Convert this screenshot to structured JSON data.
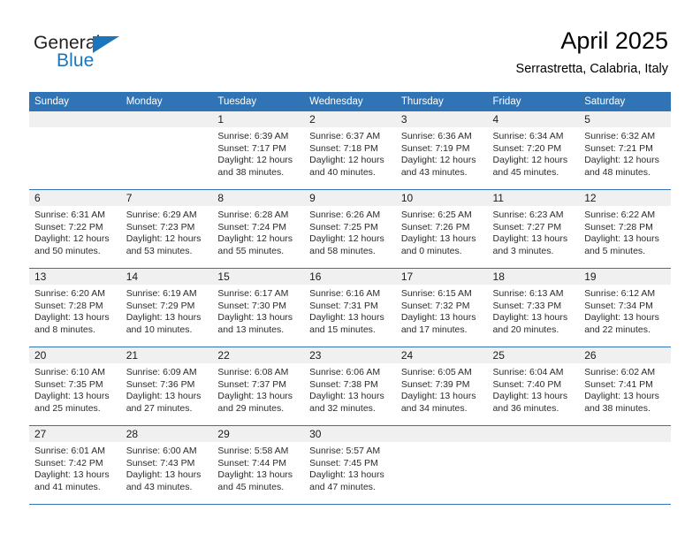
{
  "brand": {
    "name_part1": "General",
    "name_part2": "Blue",
    "flag_icon": "blue-triangle-flag"
  },
  "header": {
    "title": "April 2025",
    "subtitle": "Serrastretta, Calabria, Italy"
  },
  "colors": {
    "header_blue": "#3174b5",
    "brand_blue": "#1b75bb",
    "daynum_band": "#f0f0f0",
    "text": "#2b2b2b"
  },
  "calendar": {
    "weekdays": [
      "Sunday",
      "Monday",
      "Tuesday",
      "Wednesday",
      "Thursday",
      "Friday",
      "Saturday"
    ],
    "weeks": [
      [
        {
          "day": "",
          "blank": true
        },
        {
          "day": "",
          "blank": true
        },
        {
          "day": "1",
          "sunrise": "Sunrise: 6:39 AM",
          "sunset": "Sunset: 7:17 PM",
          "daylight": "Daylight: 12 hours and 38 minutes."
        },
        {
          "day": "2",
          "sunrise": "Sunrise: 6:37 AM",
          "sunset": "Sunset: 7:18 PM",
          "daylight": "Daylight: 12 hours and 40 minutes."
        },
        {
          "day": "3",
          "sunrise": "Sunrise: 6:36 AM",
          "sunset": "Sunset: 7:19 PM",
          "daylight": "Daylight: 12 hours and 43 minutes."
        },
        {
          "day": "4",
          "sunrise": "Sunrise: 6:34 AM",
          "sunset": "Sunset: 7:20 PM",
          "daylight": "Daylight: 12 hours and 45 minutes."
        },
        {
          "day": "5",
          "sunrise": "Sunrise: 6:32 AM",
          "sunset": "Sunset: 7:21 PM",
          "daylight": "Daylight: 12 hours and 48 minutes."
        }
      ],
      [
        {
          "day": "6",
          "sunrise": "Sunrise: 6:31 AM",
          "sunset": "Sunset: 7:22 PM",
          "daylight": "Daylight: 12 hours and 50 minutes."
        },
        {
          "day": "7",
          "sunrise": "Sunrise: 6:29 AM",
          "sunset": "Sunset: 7:23 PM",
          "daylight": "Daylight: 12 hours and 53 minutes."
        },
        {
          "day": "8",
          "sunrise": "Sunrise: 6:28 AM",
          "sunset": "Sunset: 7:24 PM",
          "daylight": "Daylight: 12 hours and 55 minutes."
        },
        {
          "day": "9",
          "sunrise": "Sunrise: 6:26 AM",
          "sunset": "Sunset: 7:25 PM",
          "daylight": "Daylight: 12 hours and 58 minutes."
        },
        {
          "day": "10",
          "sunrise": "Sunrise: 6:25 AM",
          "sunset": "Sunset: 7:26 PM",
          "daylight": "Daylight: 13 hours and 0 minutes."
        },
        {
          "day": "11",
          "sunrise": "Sunrise: 6:23 AM",
          "sunset": "Sunset: 7:27 PM",
          "daylight": "Daylight: 13 hours and 3 minutes."
        },
        {
          "day": "12",
          "sunrise": "Sunrise: 6:22 AM",
          "sunset": "Sunset: 7:28 PM",
          "daylight": "Daylight: 13 hours and 5 minutes."
        }
      ],
      [
        {
          "day": "13",
          "sunrise": "Sunrise: 6:20 AM",
          "sunset": "Sunset: 7:28 PM",
          "daylight": "Daylight: 13 hours and 8 minutes."
        },
        {
          "day": "14",
          "sunrise": "Sunrise: 6:19 AM",
          "sunset": "Sunset: 7:29 PM",
          "daylight": "Daylight: 13 hours and 10 minutes."
        },
        {
          "day": "15",
          "sunrise": "Sunrise: 6:17 AM",
          "sunset": "Sunset: 7:30 PM",
          "daylight": "Daylight: 13 hours and 13 minutes."
        },
        {
          "day": "16",
          "sunrise": "Sunrise: 6:16 AM",
          "sunset": "Sunset: 7:31 PM",
          "daylight": "Daylight: 13 hours and 15 minutes."
        },
        {
          "day": "17",
          "sunrise": "Sunrise: 6:15 AM",
          "sunset": "Sunset: 7:32 PM",
          "daylight": "Daylight: 13 hours and 17 minutes."
        },
        {
          "day": "18",
          "sunrise": "Sunrise: 6:13 AM",
          "sunset": "Sunset: 7:33 PM",
          "daylight": "Daylight: 13 hours and 20 minutes."
        },
        {
          "day": "19",
          "sunrise": "Sunrise: 6:12 AM",
          "sunset": "Sunset: 7:34 PM",
          "daylight": "Daylight: 13 hours and 22 minutes."
        }
      ],
      [
        {
          "day": "20",
          "sunrise": "Sunrise: 6:10 AM",
          "sunset": "Sunset: 7:35 PM",
          "daylight": "Daylight: 13 hours and 25 minutes."
        },
        {
          "day": "21",
          "sunrise": "Sunrise: 6:09 AM",
          "sunset": "Sunset: 7:36 PM",
          "daylight": "Daylight: 13 hours and 27 minutes."
        },
        {
          "day": "22",
          "sunrise": "Sunrise: 6:08 AM",
          "sunset": "Sunset: 7:37 PM",
          "daylight": "Daylight: 13 hours and 29 minutes."
        },
        {
          "day": "23",
          "sunrise": "Sunrise: 6:06 AM",
          "sunset": "Sunset: 7:38 PM",
          "daylight": "Daylight: 13 hours and 32 minutes."
        },
        {
          "day": "24",
          "sunrise": "Sunrise: 6:05 AM",
          "sunset": "Sunset: 7:39 PM",
          "daylight": "Daylight: 13 hours and 34 minutes."
        },
        {
          "day": "25",
          "sunrise": "Sunrise: 6:04 AM",
          "sunset": "Sunset: 7:40 PM",
          "daylight": "Daylight: 13 hours and 36 minutes."
        },
        {
          "day": "26",
          "sunrise": "Sunrise: 6:02 AM",
          "sunset": "Sunset: 7:41 PM",
          "daylight": "Daylight: 13 hours and 38 minutes."
        }
      ],
      [
        {
          "day": "27",
          "sunrise": "Sunrise: 6:01 AM",
          "sunset": "Sunset: 7:42 PM",
          "daylight": "Daylight: 13 hours and 41 minutes."
        },
        {
          "day": "28",
          "sunrise": "Sunrise: 6:00 AM",
          "sunset": "Sunset: 7:43 PM",
          "daylight": "Daylight: 13 hours and 43 minutes."
        },
        {
          "day": "29",
          "sunrise": "Sunrise: 5:58 AM",
          "sunset": "Sunset: 7:44 PM",
          "daylight": "Daylight: 13 hours and 45 minutes."
        },
        {
          "day": "30",
          "sunrise": "Sunrise: 5:57 AM",
          "sunset": "Sunset: 7:45 PM",
          "daylight": "Daylight: 13 hours and 47 minutes."
        },
        {
          "day": "",
          "blank": true
        },
        {
          "day": "",
          "blank": true
        },
        {
          "day": "",
          "blank": true
        }
      ]
    ]
  }
}
